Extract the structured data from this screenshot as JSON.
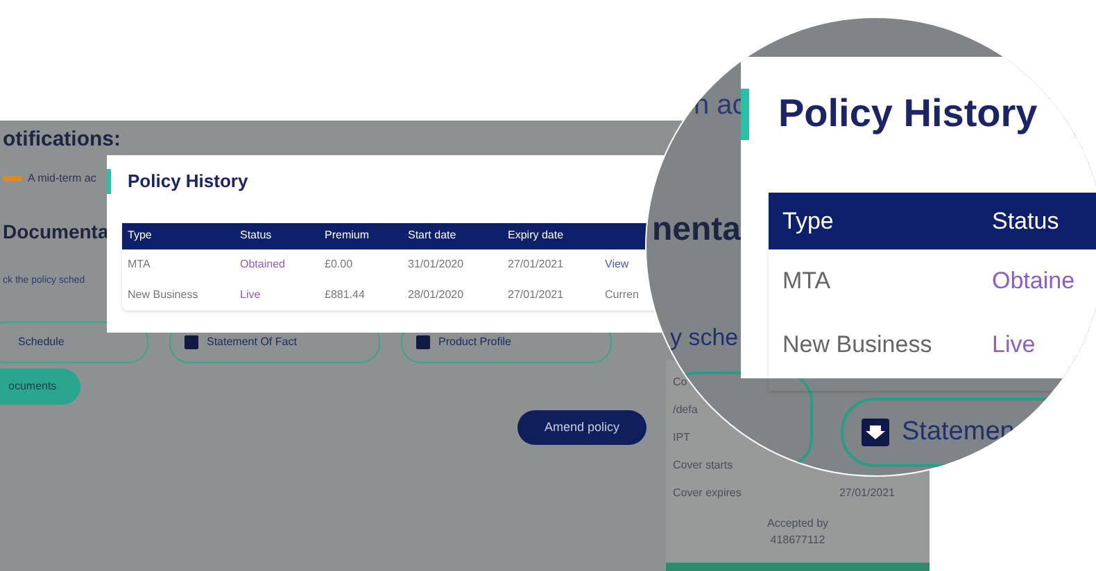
{
  "page": {
    "notifications_title": "otifications:",
    "notice": "A mid-term ac",
    "documents_heading": "Documenta",
    "instructions": "ck the policy sched",
    "document_buttons": [
      "Schedule",
      "Statement Of Fact",
      "Product Profile"
    ],
    "documents_button": "ocuments",
    "amend_button": "Amend policy",
    "summary": [
      {
        "label": "Co"
      },
      {
        "label": "/defa"
      },
      {
        "label": "IPT"
      },
      {
        "label": "Cover starts"
      },
      {
        "label": "Cover expires",
        "value": "27/01/2021"
      }
    ],
    "accepted_label": "Accepted by",
    "accepted_value": "418677112"
  },
  "modal": {
    "title": "Policy History",
    "columns": [
      "Type",
      "Status",
      "Premium",
      "Start date",
      "Expiry date"
    ],
    "rows": [
      {
        "type": "MTA",
        "status": "Obtained",
        "premium": "£0.00",
        "start": "31/01/2020",
        "expiry": "27/01/2021",
        "column_6": {
          "text": "View",
          "kind": "link"
        }
      },
      {
        "type": "New Business",
        "status": "Live",
        "premium": "£881.44",
        "start": "28/01/2020",
        "expiry": "27/01/2021",
        "column_6": {
          "text": "Curren",
          "kind": "text"
        }
      }
    ]
  },
  "magnifier": {
    "notice_fragment": "n ac",
    "heading_fragment": "nenta",
    "schedule_fragment": "y sche",
    "title": "Policy History",
    "columns": [
      "Type",
      "Status"
    ],
    "rows": [
      {
        "type": "MTA",
        "status": "Obtaine"
      },
      {
        "type": "New Business",
        "status": "Live"
      }
    ],
    "statement_button": "Statemen"
  }
}
